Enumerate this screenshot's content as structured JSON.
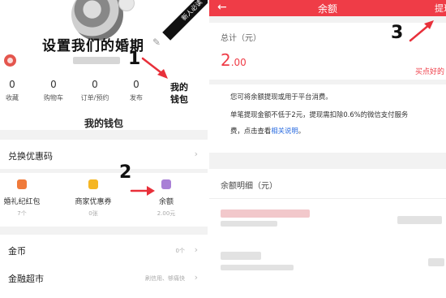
{
  "left": {
    "ribbon_text": "新人必读",
    "page_title": "设置我们的婚期",
    "stats": [
      {
        "num": "0",
        "label": "收藏"
      },
      {
        "num": "0",
        "label": "购物车"
      },
      {
        "num": "0",
        "label": "订单/预约"
      },
      {
        "num": "0",
        "label": "发布"
      }
    ],
    "wallet_link": "我的钱包",
    "wallet_title": "我的钱包",
    "coupon_label": "兑换优惠码",
    "assets": [
      {
        "name": "婚礼纪红包",
        "sub": "7个",
        "color": "#f07a3a"
      },
      {
        "name": "商家优惠券",
        "sub": "0张",
        "color": "#f5b623"
      },
      {
        "name": "余额",
        "sub": "2.00元",
        "color": "#a980d6"
      }
    ],
    "coins": {
      "label": "金币",
      "value": "0个"
    },
    "finance": {
      "label": "金融超市",
      "value": "刷信用、够痛快"
    }
  },
  "right": {
    "back_icon": "arrow-left-icon",
    "title": "余额",
    "top_right": "提现",
    "total_label": "总计（元）",
    "amount_int": "2",
    "amount_dec": ".00",
    "buy_link": "买点好的",
    "note_line1": "您可将余额提现或用于平台消费。",
    "note_line2": "单笔提现金额不低于2元，提现需扣除0.6%的微信支付服务",
    "note_line3_pre": "费，点击查看",
    "note_line3_link": "相关说明",
    "note_line3_post": "。",
    "detail_title": "余额明细（元）"
  },
  "annotations": {
    "n1": "1",
    "n2": "2",
    "n3": "3"
  },
  "colors": {
    "accent": "#ef3c47",
    "link": "#2b6ce0"
  }
}
